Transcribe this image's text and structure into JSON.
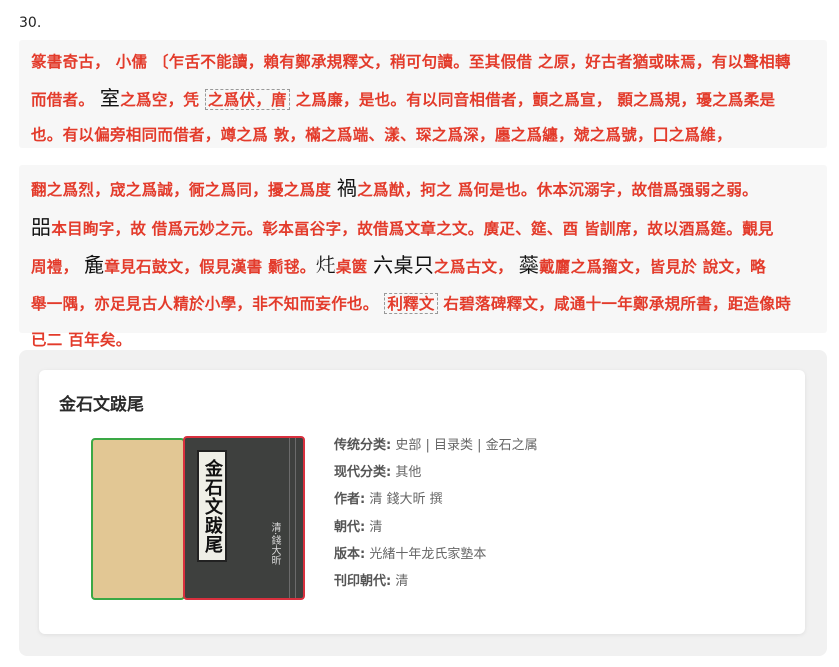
{
  "question_number": "30.",
  "passage1": {
    "line1": "篆書奇古， 小儒 〔乍舌不能讀，賴有鄭承規釋文，稍可句讀。至其假借 之原，好古者猶或昧焉，有以聲相轉",
    "line2_a": "而借者。",
    "line2_b": "之爲空，凭 ",
    "line2_boxed": "之爲伏，庴",
    "line2_c": " 之爲廉，是也。有以同音相借者，顫之爲宣， 顥之爲規，瓇之爲柔是",
    "line3": "也。有以偏旁相同而借者，竴之爲 敦，樠之爲端、漾、琛之爲深，廛之爲纏，虠之爲號，囗之爲維，",
    "glyph_a": "室"
  },
  "passage2": {
    "line1_a": "翻之爲烈，宬之爲誠，衕之爲同，擾之爲度 ",
    "glyph_b": "禍",
    "line1_b": "之爲猷，抲之 爲何是也。休本沉溺字，故借爲强弱之弱。",
    "glyph_c": "㗊",
    "line2": "本目眴字，故 借爲元妙之元。彰本畐谷字，故借爲文章之文。廣疋、筵、酉 皆訓席，故以酒爲筵。覿見",
    "line3_a": "周禮， ",
    "glyph_d": "麁",
    "line3_b": "章見石鼓文，假見漢書 鬎毬。",
    "glyph_e": "𤆚",
    "line3_c": "桌篋 ",
    "glyph_f": "六桌只",
    "line3_d": "之爲古文， ",
    "glyph_g": "蘂",
    "line3_e": "戴廲之爲籀文，皆見於 說文，略",
    "line4_a": "舉一隅，亦足見古人精於小學，非不知而妄作也。 ",
    "line4_boxed": "利釋文",
    "line4_b": " 右碧落碑釋文，咸通十一年鄭承規所書，距造像時",
    "line5": "已二 百年矣。"
  },
  "card": {
    "title": "金石文跋尾",
    "cover_title": "金石文跋尾",
    "cover_author": "清·錢大昕",
    "fields": [
      {
        "key": "传统分类:",
        "value": "史部 | 目录类 | 金石之属"
      },
      {
        "key": "现代分类:",
        "value": "其他"
      },
      {
        "key": "作者:",
        "value": "清 錢大昕 撰"
      },
      {
        "key": "朝代:",
        "value": "清"
      },
      {
        "key": "版本:",
        "value": "光緒十年龙氏家塾本"
      },
      {
        "key": "刊印朝代:",
        "value": "清"
      }
    ]
  },
  "colors": {
    "passage_text": "#e33b2b",
    "panel_bg": "#f7f7f7",
    "back_cover": "#e2c794",
    "front_cover": "#3e403e"
  }
}
